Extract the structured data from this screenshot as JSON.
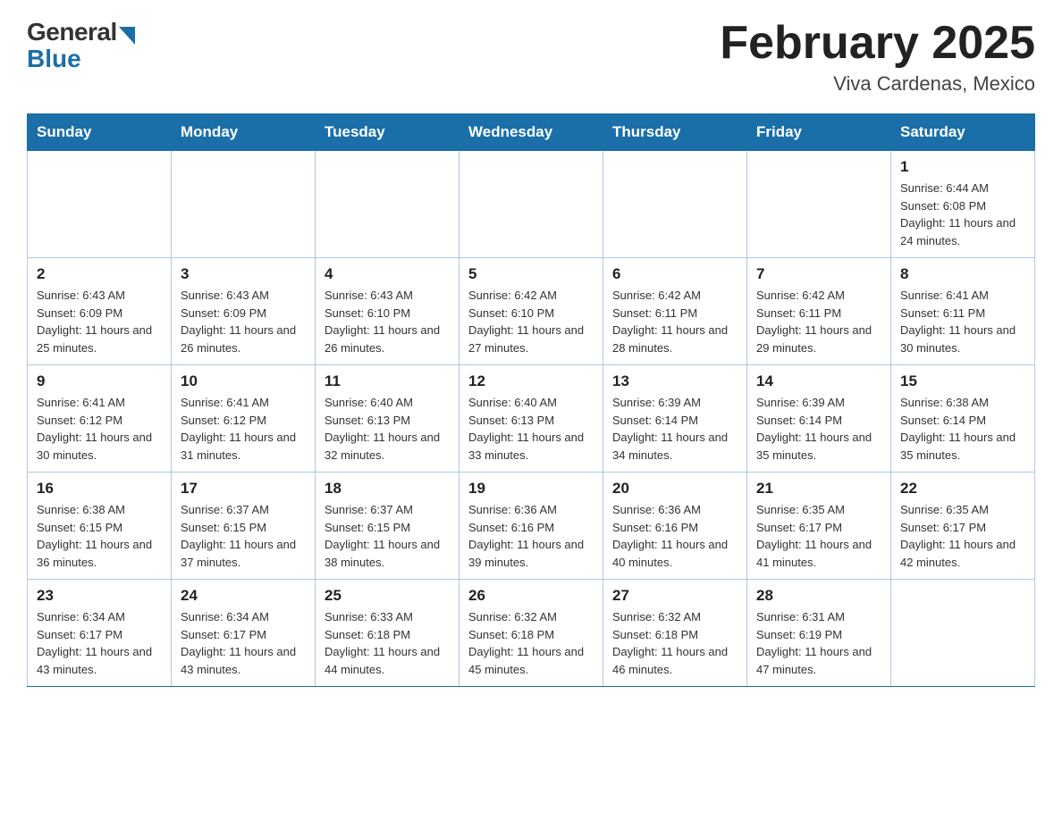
{
  "header": {
    "logo_general": "General",
    "logo_blue": "Blue",
    "month_title": "February 2025",
    "location": "Viva Cardenas, Mexico"
  },
  "days_of_week": [
    "Sunday",
    "Monday",
    "Tuesday",
    "Wednesday",
    "Thursday",
    "Friday",
    "Saturday"
  ],
  "weeks": [
    [
      {
        "day": "",
        "info": ""
      },
      {
        "day": "",
        "info": ""
      },
      {
        "day": "",
        "info": ""
      },
      {
        "day": "",
        "info": ""
      },
      {
        "day": "",
        "info": ""
      },
      {
        "day": "",
        "info": ""
      },
      {
        "day": "1",
        "info": "Sunrise: 6:44 AM\nSunset: 6:08 PM\nDaylight: 11 hours and 24 minutes."
      }
    ],
    [
      {
        "day": "2",
        "info": "Sunrise: 6:43 AM\nSunset: 6:09 PM\nDaylight: 11 hours and 25 minutes."
      },
      {
        "day": "3",
        "info": "Sunrise: 6:43 AM\nSunset: 6:09 PM\nDaylight: 11 hours and 26 minutes."
      },
      {
        "day": "4",
        "info": "Sunrise: 6:43 AM\nSunset: 6:10 PM\nDaylight: 11 hours and 26 minutes."
      },
      {
        "day": "5",
        "info": "Sunrise: 6:42 AM\nSunset: 6:10 PM\nDaylight: 11 hours and 27 minutes."
      },
      {
        "day": "6",
        "info": "Sunrise: 6:42 AM\nSunset: 6:11 PM\nDaylight: 11 hours and 28 minutes."
      },
      {
        "day": "7",
        "info": "Sunrise: 6:42 AM\nSunset: 6:11 PM\nDaylight: 11 hours and 29 minutes."
      },
      {
        "day": "8",
        "info": "Sunrise: 6:41 AM\nSunset: 6:11 PM\nDaylight: 11 hours and 30 minutes."
      }
    ],
    [
      {
        "day": "9",
        "info": "Sunrise: 6:41 AM\nSunset: 6:12 PM\nDaylight: 11 hours and 30 minutes."
      },
      {
        "day": "10",
        "info": "Sunrise: 6:41 AM\nSunset: 6:12 PM\nDaylight: 11 hours and 31 minutes."
      },
      {
        "day": "11",
        "info": "Sunrise: 6:40 AM\nSunset: 6:13 PM\nDaylight: 11 hours and 32 minutes."
      },
      {
        "day": "12",
        "info": "Sunrise: 6:40 AM\nSunset: 6:13 PM\nDaylight: 11 hours and 33 minutes."
      },
      {
        "day": "13",
        "info": "Sunrise: 6:39 AM\nSunset: 6:14 PM\nDaylight: 11 hours and 34 minutes."
      },
      {
        "day": "14",
        "info": "Sunrise: 6:39 AM\nSunset: 6:14 PM\nDaylight: 11 hours and 35 minutes."
      },
      {
        "day": "15",
        "info": "Sunrise: 6:38 AM\nSunset: 6:14 PM\nDaylight: 11 hours and 35 minutes."
      }
    ],
    [
      {
        "day": "16",
        "info": "Sunrise: 6:38 AM\nSunset: 6:15 PM\nDaylight: 11 hours and 36 minutes."
      },
      {
        "day": "17",
        "info": "Sunrise: 6:37 AM\nSunset: 6:15 PM\nDaylight: 11 hours and 37 minutes."
      },
      {
        "day": "18",
        "info": "Sunrise: 6:37 AM\nSunset: 6:15 PM\nDaylight: 11 hours and 38 minutes."
      },
      {
        "day": "19",
        "info": "Sunrise: 6:36 AM\nSunset: 6:16 PM\nDaylight: 11 hours and 39 minutes."
      },
      {
        "day": "20",
        "info": "Sunrise: 6:36 AM\nSunset: 6:16 PM\nDaylight: 11 hours and 40 minutes."
      },
      {
        "day": "21",
        "info": "Sunrise: 6:35 AM\nSunset: 6:17 PM\nDaylight: 11 hours and 41 minutes."
      },
      {
        "day": "22",
        "info": "Sunrise: 6:35 AM\nSunset: 6:17 PM\nDaylight: 11 hours and 42 minutes."
      }
    ],
    [
      {
        "day": "23",
        "info": "Sunrise: 6:34 AM\nSunset: 6:17 PM\nDaylight: 11 hours and 43 minutes."
      },
      {
        "day": "24",
        "info": "Sunrise: 6:34 AM\nSunset: 6:17 PM\nDaylight: 11 hours and 43 minutes."
      },
      {
        "day": "25",
        "info": "Sunrise: 6:33 AM\nSunset: 6:18 PM\nDaylight: 11 hours and 44 minutes."
      },
      {
        "day": "26",
        "info": "Sunrise: 6:32 AM\nSunset: 6:18 PM\nDaylight: 11 hours and 45 minutes."
      },
      {
        "day": "27",
        "info": "Sunrise: 6:32 AM\nSunset: 6:18 PM\nDaylight: 11 hours and 46 minutes."
      },
      {
        "day": "28",
        "info": "Sunrise: 6:31 AM\nSunset: 6:19 PM\nDaylight: 11 hours and 47 minutes."
      },
      {
        "day": "",
        "info": ""
      }
    ]
  ]
}
